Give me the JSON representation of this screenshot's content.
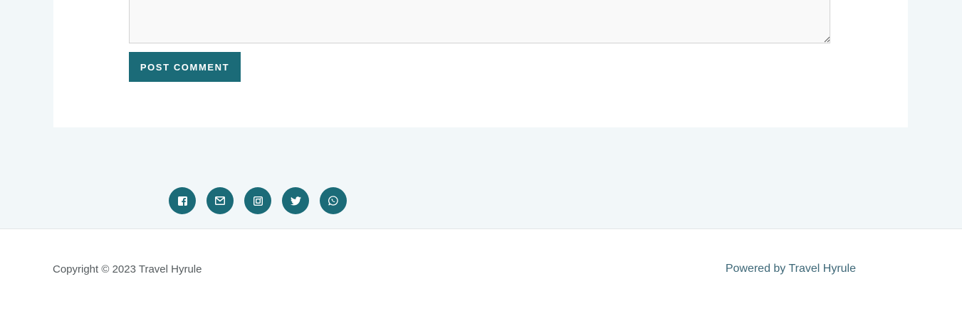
{
  "comment_form": {
    "textarea_value": "",
    "submit_label": "POST COMMENT"
  },
  "social": {
    "icons": [
      "facebook-icon",
      "email-icon",
      "instagram-icon",
      "twitter-icon",
      "whatsapp-icon"
    ]
  },
  "footer": {
    "copyright": "Copyright © 2023 Travel Hyrule",
    "powered_by": "Powered by Travel Hyrule"
  },
  "colors": {
    "accent": "#1b6b78",
    "page_background": "#f2f7f9",
    "card_background": "#ffffff"
  }
}
